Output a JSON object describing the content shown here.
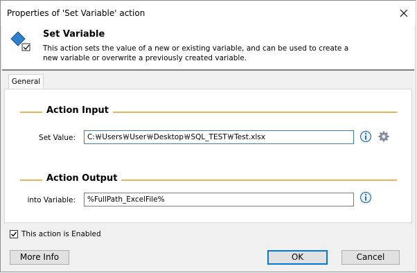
{
  "window": {
    "title": "Properties of 'Set Variable' action"
  },
  "header": {
    "action_name": "Set Variable",
    "description": "This action sets the value of a new or existing variable, and can be used to create a new variable or overwrite a previously created variable."
  },
  "tabs": [
    {
      "label": "General"
    }
  ],
  "input_section": {
    "title": "Action Input",
    "set_value_label": "Set Value:",
    "set_value": "C:￦Users￦User￦Desktop￦SQL_TEST￦Test.xlsx"
  },
  "output_section": {
    "title": "Action Output",
    "into_variable_label": "into Variable:",
    "into_variable": "%FullPath_ExcelFile%"
  },
  "enabled": {
    "label": "This action is Enabled",
    "checked": true
  },
  "buttons": {
    "more_info": "More Info",
    "ok": "OK",
    "cancel": "Cancel"
  },
  "colors": {
    "section_line": "#e8b45a",
    "focus_blue": "#0078d7",
    "icon_blue": "#2b6cc0"
  },
  "icons": [
    "close-icon",
    "set-variable-icon",
    "info-icon",
    "gear-icon",
    "check-icon"
  ]
}
